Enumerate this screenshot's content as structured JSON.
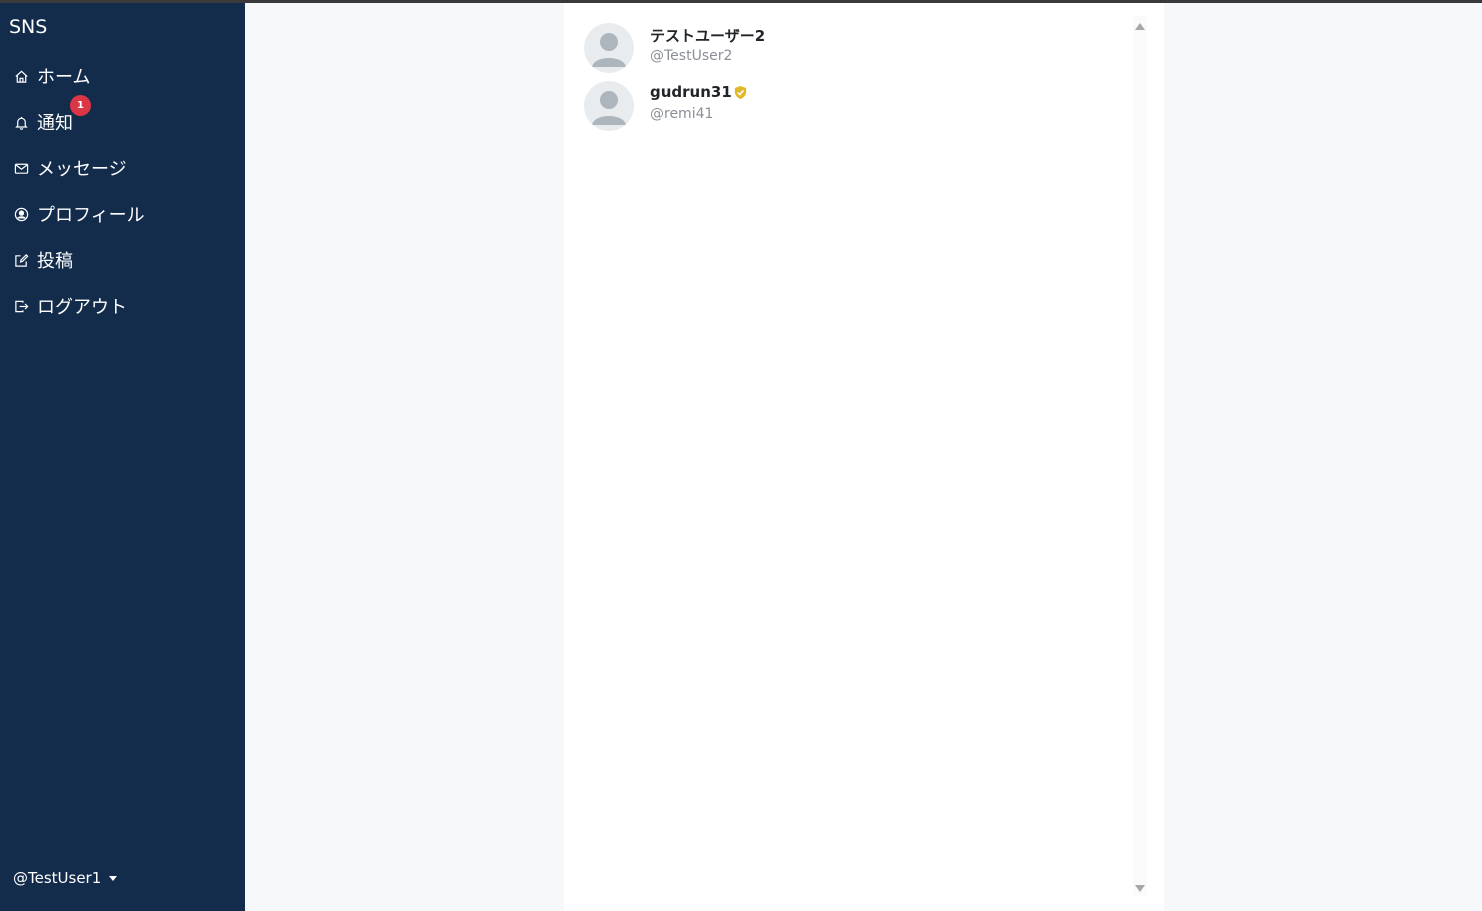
{
  "sidebar": {
    "brand": "SNS",
    "items": [
      {
        "label": "ホーム",
        "icon": "house-icon"
      },
      {
        "label": "通知",
        "icon": "bell-icon"
      },
      {
        "label": "メッセージ",
        "icon": "envelope-icon"
      },
      {
        "label": "プロフィール",
        "icon": "person-circle-icon"
      },
      {
        "label": "投稿",
        "icon": "pencil-square-icon"
      },
      {
        "label": "ログアウト",
        "icon": "box-arrow-right-icon"
      }
    ],
    "notification_count": "1",
    "current_user": "@TestUser1"
  },
  "users": [
    {
      "display_name": "テストユーザー2",
      "handle": "@TestUser2",
      "verified": false
    },
    {
      "display_name": "gudrun31",
      "handle": "@remi41",
      "verified": true
    }
  ],
  "colors": {
    "sidebar_bg": "#132c4b",
    "badge": "#dc3545",
    "verified": "#e0b92a",
    "page_bg": "#f7f8fa"
  }
}
